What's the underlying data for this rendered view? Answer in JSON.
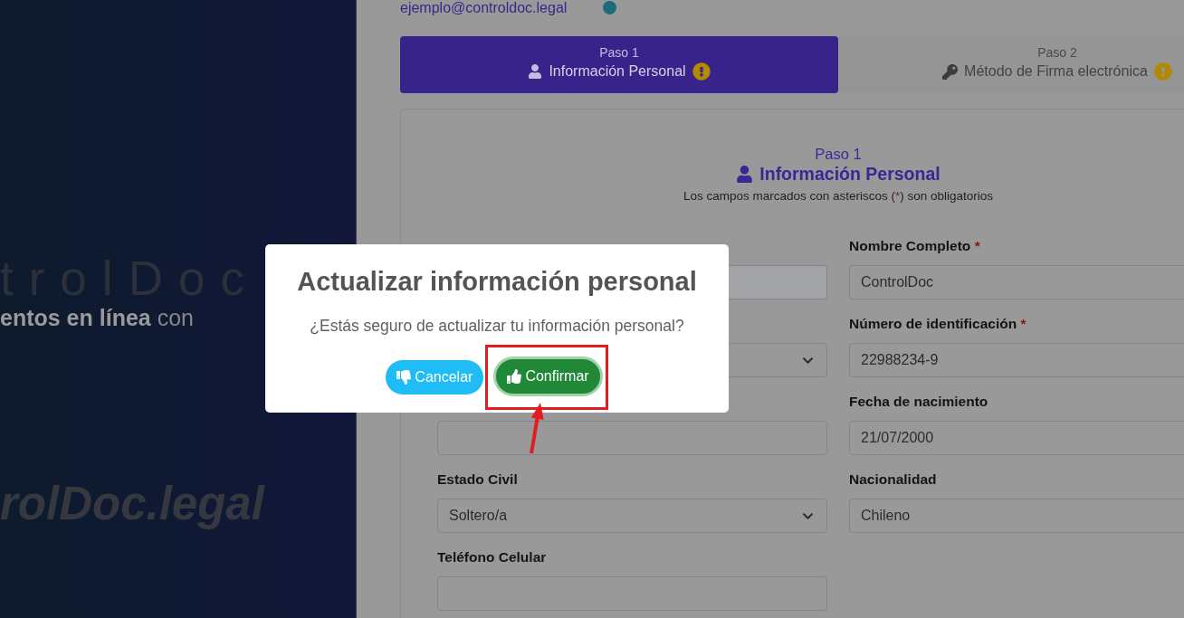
{
  "brand_panel": {
    "logo_text": "trolDoc",
    "tagline": "**entos en línea** con",
    "wordmark": "rolDoc.legal"
  },
  "account": {
    "email": "ejemplo@controldoc.legal"
  },
  "steps": [
    {
      "step": "Paso 1",
      "label": "Información Personal",
      "warning": true,
      "selected": true
    },
    {
      "step": "Paso 2",
      "label": "Método de Firma electrónica",
      "warning": true,
      "selected": false
    }
  ],
  "form": {
    "step": "Paso 1",
    "title": "Información Personal",
    "note": {
      "before": "Los campos marcados con asteriscos (",
      "mark": "*",
      "after": ") son obligatorios"
    },
    "fields": [
      {
        "kind": "input",
        "disabled": true
      },
      {
        "kind": "input",
        "label": "Nombre Completo",
        "required_mark": "*",
        "value": "ControlDoc",
        "disabled": false
      },
      {
        "kind": "select",
        "disabled": false
      },
      {
        "kind": "input",
        "label": "Número de identificación",
        "required_mark": "*",
        "value": "22988234-9",
        "disabled": false
      },
      {
        "kind": "input",
        "disabled": false
      },
      {
        "kind": "input",
        "label": "Fecha de nacimiento",
        "value": "21/07/2000",
        "disabled": false
      },
      {
        "kind": "select",
        "label": "Estado Civil",
        "value": "Soltero/a",
        "disabled": false
      },
      {
        "kind": "input",
        "label": "Nacionalidad",
        "value": "Chileno",
        "disabled": false
      },
      {
        "kind": "input",
        "label": "Teléfono Celular",
        "disabled": false
      }
    ]
  },
  "modal": {
    "title": "Actualizar información personal",
    "message": "¿Estás seguro de actualizar tu información personal?",
    "buttons": [
      {
        "kind": "cancel",
        "label": "Cancelar",
        "focused": false,
        "highlighted": false
      },
      {
        "kind": "confirm",
        "label": "Confirmar",
        "focused": true,
        "highlighted": true
      }
    ]
  }
}
